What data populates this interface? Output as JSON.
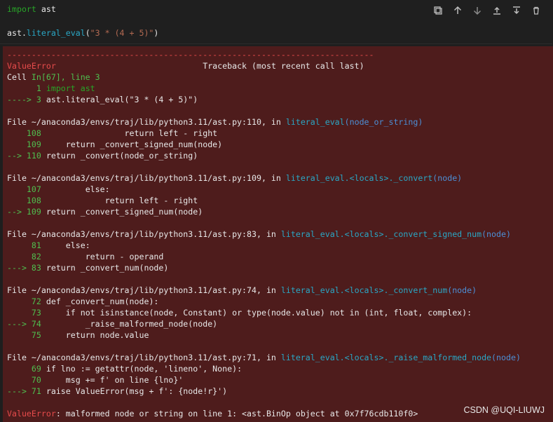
{
  "cell": {
    "line1": "import ast",
    "line2": "ast.literal_eval(\"3 * (4 + 5)\")"
  },
  "toolbar": [
    {
      "name": "copy-icon"
    },
    {
      "name": "move-up-icon"
    },
    {
      "name": "move-down-icon"
    },
    {
      "name": "insert-above-icon"
    },
    {
      "name": "insert-below-icon"
    },
    {
      "name": "delete-icon"
    }
  ],
  "traceback": {
    "sep": "---------------------------------------------------------------------------",
    "error_name": "ValueError",
    "header": "Traceback (most recent call last)",
    "cell_prefix": "Cell ",
    "cell_ref": "In[67], line 3",
    "frames": [
      {
        "file_text": "File ~/anaconda3/envs/traj/lib/python3.11/ast.py:110, in ",
        "func": "literal_eval",
        "args": "(node_or_string)",
        "lines": [
          {
            "arrow": "    ",
            "num": "108",
            "code": "                return left - right"
          },
          {
            "arrow": "    ",
            "num": "109",
            "code": "    return _convert_signed_num(node)"
          },
          {
            "arrow": "--> ",
            "num": "110",
            "code": "return _convert(node_or_string)"
          }
        ]
      },
      {
        "file_text": "File ~/anaconda3/envs/traj/lib/python3.11/ast.py:109, in ",
        "func": "literal_eval.<locals>._convert",
        "args": "(node)",
        "lines": [
          {
            "arrow": "    ",
            "num": "107",
            "code": "        else:"
          },
          {
            "arrow": "    ",
            "num": "108",
            "code": "            return left - right"
          },
          {
            "arrow": "--> ",
            "num": "109",
            "code": "return _convert_signed_num(node)"
          }
        ]
      },
      {
        "file_text": "File ~/anaconda3/envs/traj/lib/python3.11/ast.py:83, in ",
        "func": "literal_eval.<locals>._convert_signed_num",
        "args": "(node)",
        "lines": [
          {
            "arrow": "     ",
            "num": "81",
            "code": "    else:"
          },
          {
            "arrow": "     ",
            "num": "82",
            "code": "        return - operand"
          },
          {
            "arrow": "---> ",
            "num": "83",
            "code": "return _convert_num(node)"
          }
        ]
      },
      {
        "file_text": "File ~/anaconda3/envs/traj/lib/python3.11/ast.py:74, in ",
        "func": "literal_eval.<locals>._convert_num",
        "args": "(node)",
        "lines": [
          {
            "arrow": "     ",
            "num": "72",
            "code": "def _convert_num(node):"
          },
          {
            "arrow": "     ",
            "num": "73",
            "code": "    if not isinstance(node, Constant) or type(node.value) not in (int, float, complex):"
          },
          {
            "arrow": "---> ",
            "num": "74",
            "code": "        _raise_malformed_node(node)"
          },
          {
            "arrow": "     ",
            "num": "75",
            "code": "    return node.value"
          }
        ]
      },
      {
        "file_text": "File ~/anaconda3/envs/traj/lib/python3.11/ast.py:71, in ",
        "func": "literal_eval.<locals>._raise_malformed_node",
        "args": "(node)",
        "lines": [
          {
            "arrow": "     ",
            "num": "69",
            "code": "if lno := getattr(node, 'lineno', None):"
          },
          {
            "arrow": "     ",
            "num": "70",
            "code": "    msg += f' on line {lno}'"
          },
          {
            "arrow": "---> ",
            "num": "71",
            "code": "raise ValueError(msg + f': {node!r}')"
          }
        ]
      }
    ],
    "cell_lines": [
      {
        "arrow": "      ",
        "num": "1",
        "code": "import ast"
      },
      {
        "arrow": "----> ",
        "num": "3",
        "code": "ast.literal_eval(\"3 * (4 + 5)\")"
      }
    ],
    "final_name": "ValueError",
    "final_msg": ": malformed node or string on line 1: <ast.BinOp object at 0x7f76cdb110f0>"
  },
  "watermark": "CSDN @UQI-LIUWJ"
}
